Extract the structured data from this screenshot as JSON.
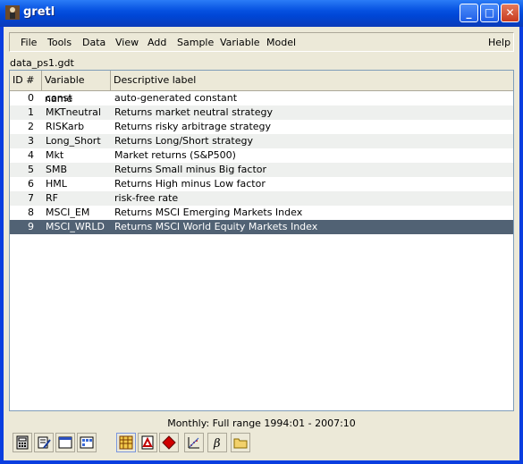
{
  "window": {
    "title": "gretl",
    "minimize": "_",
    "maximize": "□",
    "close": "✕"
  },
  "menu": {
    "file": "File",
    "tools": "Tools",
    "data": "Data",
    "view": "View",
    "add": "Add",
    "sample": "Sample",
    "variable": "Variable",
    "model": "Model",
    "help": "Help"
  },
  "dataset": {
    "filename": "data_ps1.gdt"
  },
  "table": {
    "columns": [
      "ID #",
      "Variable name",
      "Descriptive label"
    ],
    "rows": [
      {
        "id": "0",
        "name": "const",
        "label": "auto-generated constant"
      },
      {
        "id": "1",
        "name": "MKTneutral",
        "label": "Returns market neutral strategy"
      },
      {
        "id": "2",
        "name": "RISKarb",
        "label": "Returns risky arbitrage strategy"
      },
      {
        "id": "3",
        "name": "Long_Short",
        "label": "Returns Long/Short strategy"
      },
      {
        "id": "4",
        "name": "Mkt",
        "label": "Market returns (S&P500)"
      },
      {
        "id": "5",
        "name": "SMB",
        "label": "Returns Small minus Big factor"
      },
      {
        "id": "6",
        "name": "HML",
        "label": "Returns High minus Low factor"
      },
      {
        "id": "7",
        "name": "RF",
        "label": "risk-free rate"
      },
      {
        "id": "8",
        "name": "MSCI_EM",
        "label": "Returns MSCI Emerging Markets Index"
      },
      {
        "id": "9",
        "name": "MSCI_WRLD",
        "label": "Returns MSCI World Equity Markets Index"
      }
    ],
    "selected_index": 9
  },
  "status": {
    "text": "Monthly: Full range 1994:01 - 2007:10"
  },
  "toolbar_icons": [
    "calculator-icon",
    "edit-icon",
    "terminal-icon",
    "session-icon",
    "grid-icon",
    "pdf-icon",
    "ruby-icon",
    "plot-icon",
    "beta-icon",
    "folder-icon"
  ],
  "colors": {
    "selection": "#516274",
    "titlebar": "#0550e0"
  }
}
